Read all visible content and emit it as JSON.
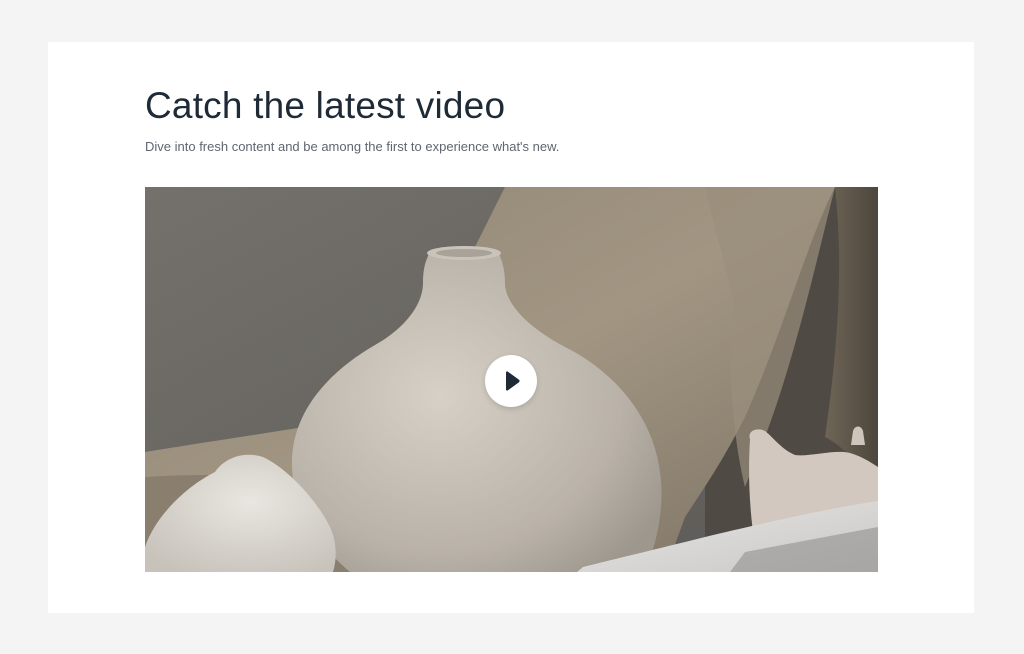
{
  "section": {
    "title": "Catch the latest video",
    "subtitle": "Dive into fresh content and be among the first to experience what's new."
  },
  "video": {
    "play_icon": "play-icon"
  },
  "colors": {
    "page_background": "#f4f4f4",
    "card_background": "#ffffff",
    "title_text": "#1f2a37",
    "subtitle_text": "#5f6670",
    "play_button_background": "#ffffff",
    "play_icon": "#1f2a37"
  }
}
